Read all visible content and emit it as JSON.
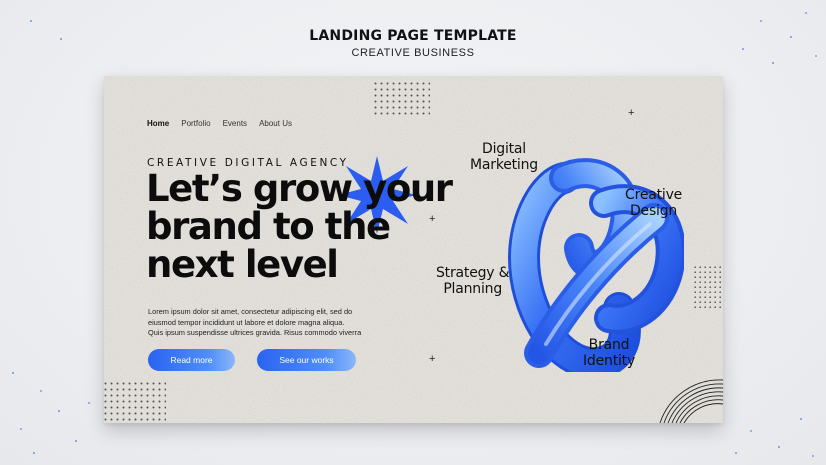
{
  "showcase": {
    "title": "LANDING PAGE TEMPLATE",
    "subtitle": "CREATIVE BUSINESS"
  },
  "nav": {
    "items": [
      {
        "label": "Home"
      },
      {
        "label": "Portfolio"
      },
      {
        "label": "Events"
      },
      {
        "label": "About Us"
      }
    ]
  },
  "hero": {
    "eyebrow": "CREATIVE DIGITAL AGENCY",
    "headline_lines": [
      "Let’s grow your",
      "brand to the",
      "next level"
    ],
    "body_lines": [
      "Lorem ipsum dolor sit amet, consectetur adipiscing elit, sed do",
      "eiusmod tempor incididunt ut labore et dolore magna aliqua.",
      "Quis ipsum suspendisse ultrices gravida. Risus commodo viverra"
    ],
    "primary_button": "Read more",
    "secondary_button": "See our works"
  },
  "services": [
    {
      "lines": [
        "Digital",
        "Marketing"
      ]
    },
    {
      "lines": [
        "Creative",
        "Design"
      ]
    },
    {
      "lines": [
        "Strategy &",
        "Planning"
      ]
    },
    {
      "lines": [
        "Brand",
        "Identity"
      ]
    }
  ],
  "colors": {
    "accent": "#2a63f2",
    "accent_light": "#8db6fa",
    "card_bg": "#ebe8e3",
    "text": "#0c0c0c"
  },
  "icons": [
    "starburst-icon",
    "plus-icon",
    "dot-grid",
    "concentric-arcs",
    "loop-3d-shape"
  ]
}
